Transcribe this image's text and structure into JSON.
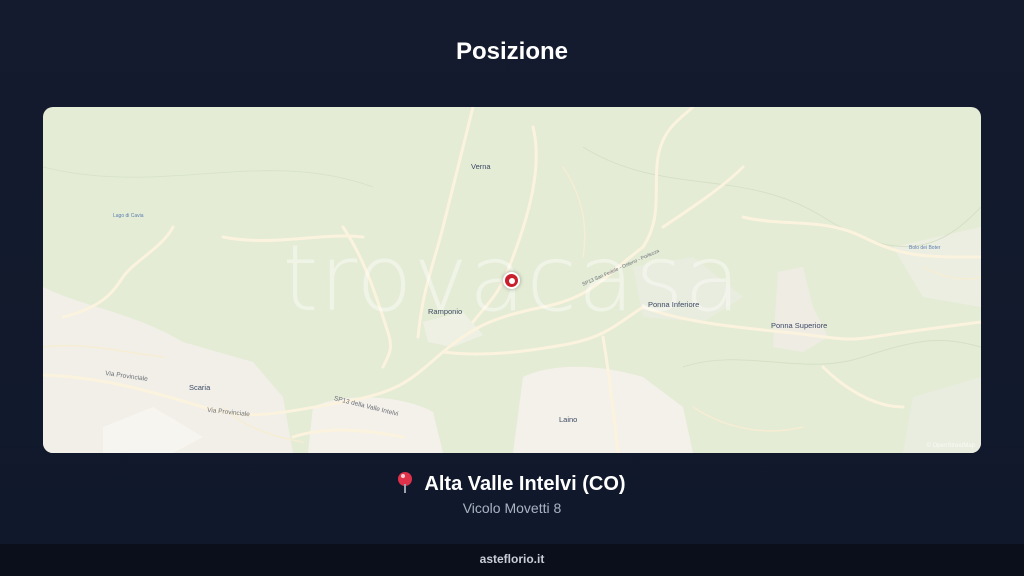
{
  "header": {
    "title": "Posizione"
  },
  "map": {
    "watermark": "trovacasa",
    "attribution": "© OpenStreetMap",
    "places": {
      "verna": "Verna",
      "ramponio": "Ramponio",
      "ponna_inferiore": "Ponna Inferiore",
      "ponna_superiore": "Ponna Superiore",
      "scaria": "Scaria",
      "laino": "Laino"
    },
    "roads": {
      "via_provinciale_1": "Via Provinciale",
      "via_provinciale_2": "Via Provinciale",
      "sp13": "SP13 della Valle Intelvi",
      "sp_san_fedele": "SP13 San Fedele - Osteno - Porlezza"
    },
    "water": {
      "lago_left": "Lago di Cavia",
      "lago_right": "Bolo dei Boter"
    },
    "colors": {
      "land": "#e4ecd6",
      "road": "#fbf3de",
      "urban": "#f4f1ea",
      "pin": "#c8202d"
    }
  },
  "location": {
    "municipality": "Alta Valle Intelvi (CO)",
    "address": "Vicolo Movetti 8"
  },
  "footer": {
    "site": "asteflorio.it"
  }
}
